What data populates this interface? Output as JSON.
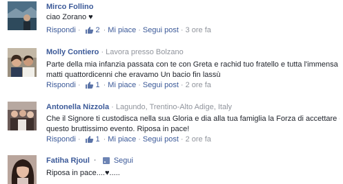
{
  "comments": [
    {
      "author": "Mirco Follino",
      "meta": "",
      "lines": [
        "ciao Zorano ♥"
      ],
      "actions": {
        "reply": "Rispondi",
        "likes": "2",
        "like": "Mi piace",
        "follow": "Segui post",
        "time": "3 ore fa"
      }
    },
    {
      "author": "Molly Contiero",
      "meta": "· Lavora presso Bolzano",
      "lines": [
        "Parte della mia infanzia passata con te con Greta e rachid tuo fratello e tutta l'immensa com",
        "matti quattordicenni che eravamo Un bacio fin lassù"
      ],
      "actions": {
        "reply": "Rispondi",
        "likes": "1",
        "like": "Mi piace",
        "follow": "Segui post",
        "time": "2 ore fa"
      }
    },
    {
      "author": "Antonella Nizzola",
      "meta": "· Lagundo, Trentino-Alto Adige, Italy",
      "lines": [
        "Che il Signore ti custodisca nella sua Gloria e dia alla tua famiglia la Forza di accettare e su",
        "questo bruttissimo evento. Riposa in pace!"
      ],
      "actions": {
        "reply": "Rispondi",
        "likes": "1",
        "like": "Mi piace",
        "follow": "Segui post",
        "time": "2 ore fa"
      }
    },
    {
      "author": "Fatiha Rjoul",
      "meta": "Segui",
      "lines": [
        "Riposa in pace....♥....."
      ],
      "actions": {}
    }
  ],
  "colors": {
    "link": "#3b5998",
    "muted": "#90949c",
    "text": "#1d2129"
  }
}
